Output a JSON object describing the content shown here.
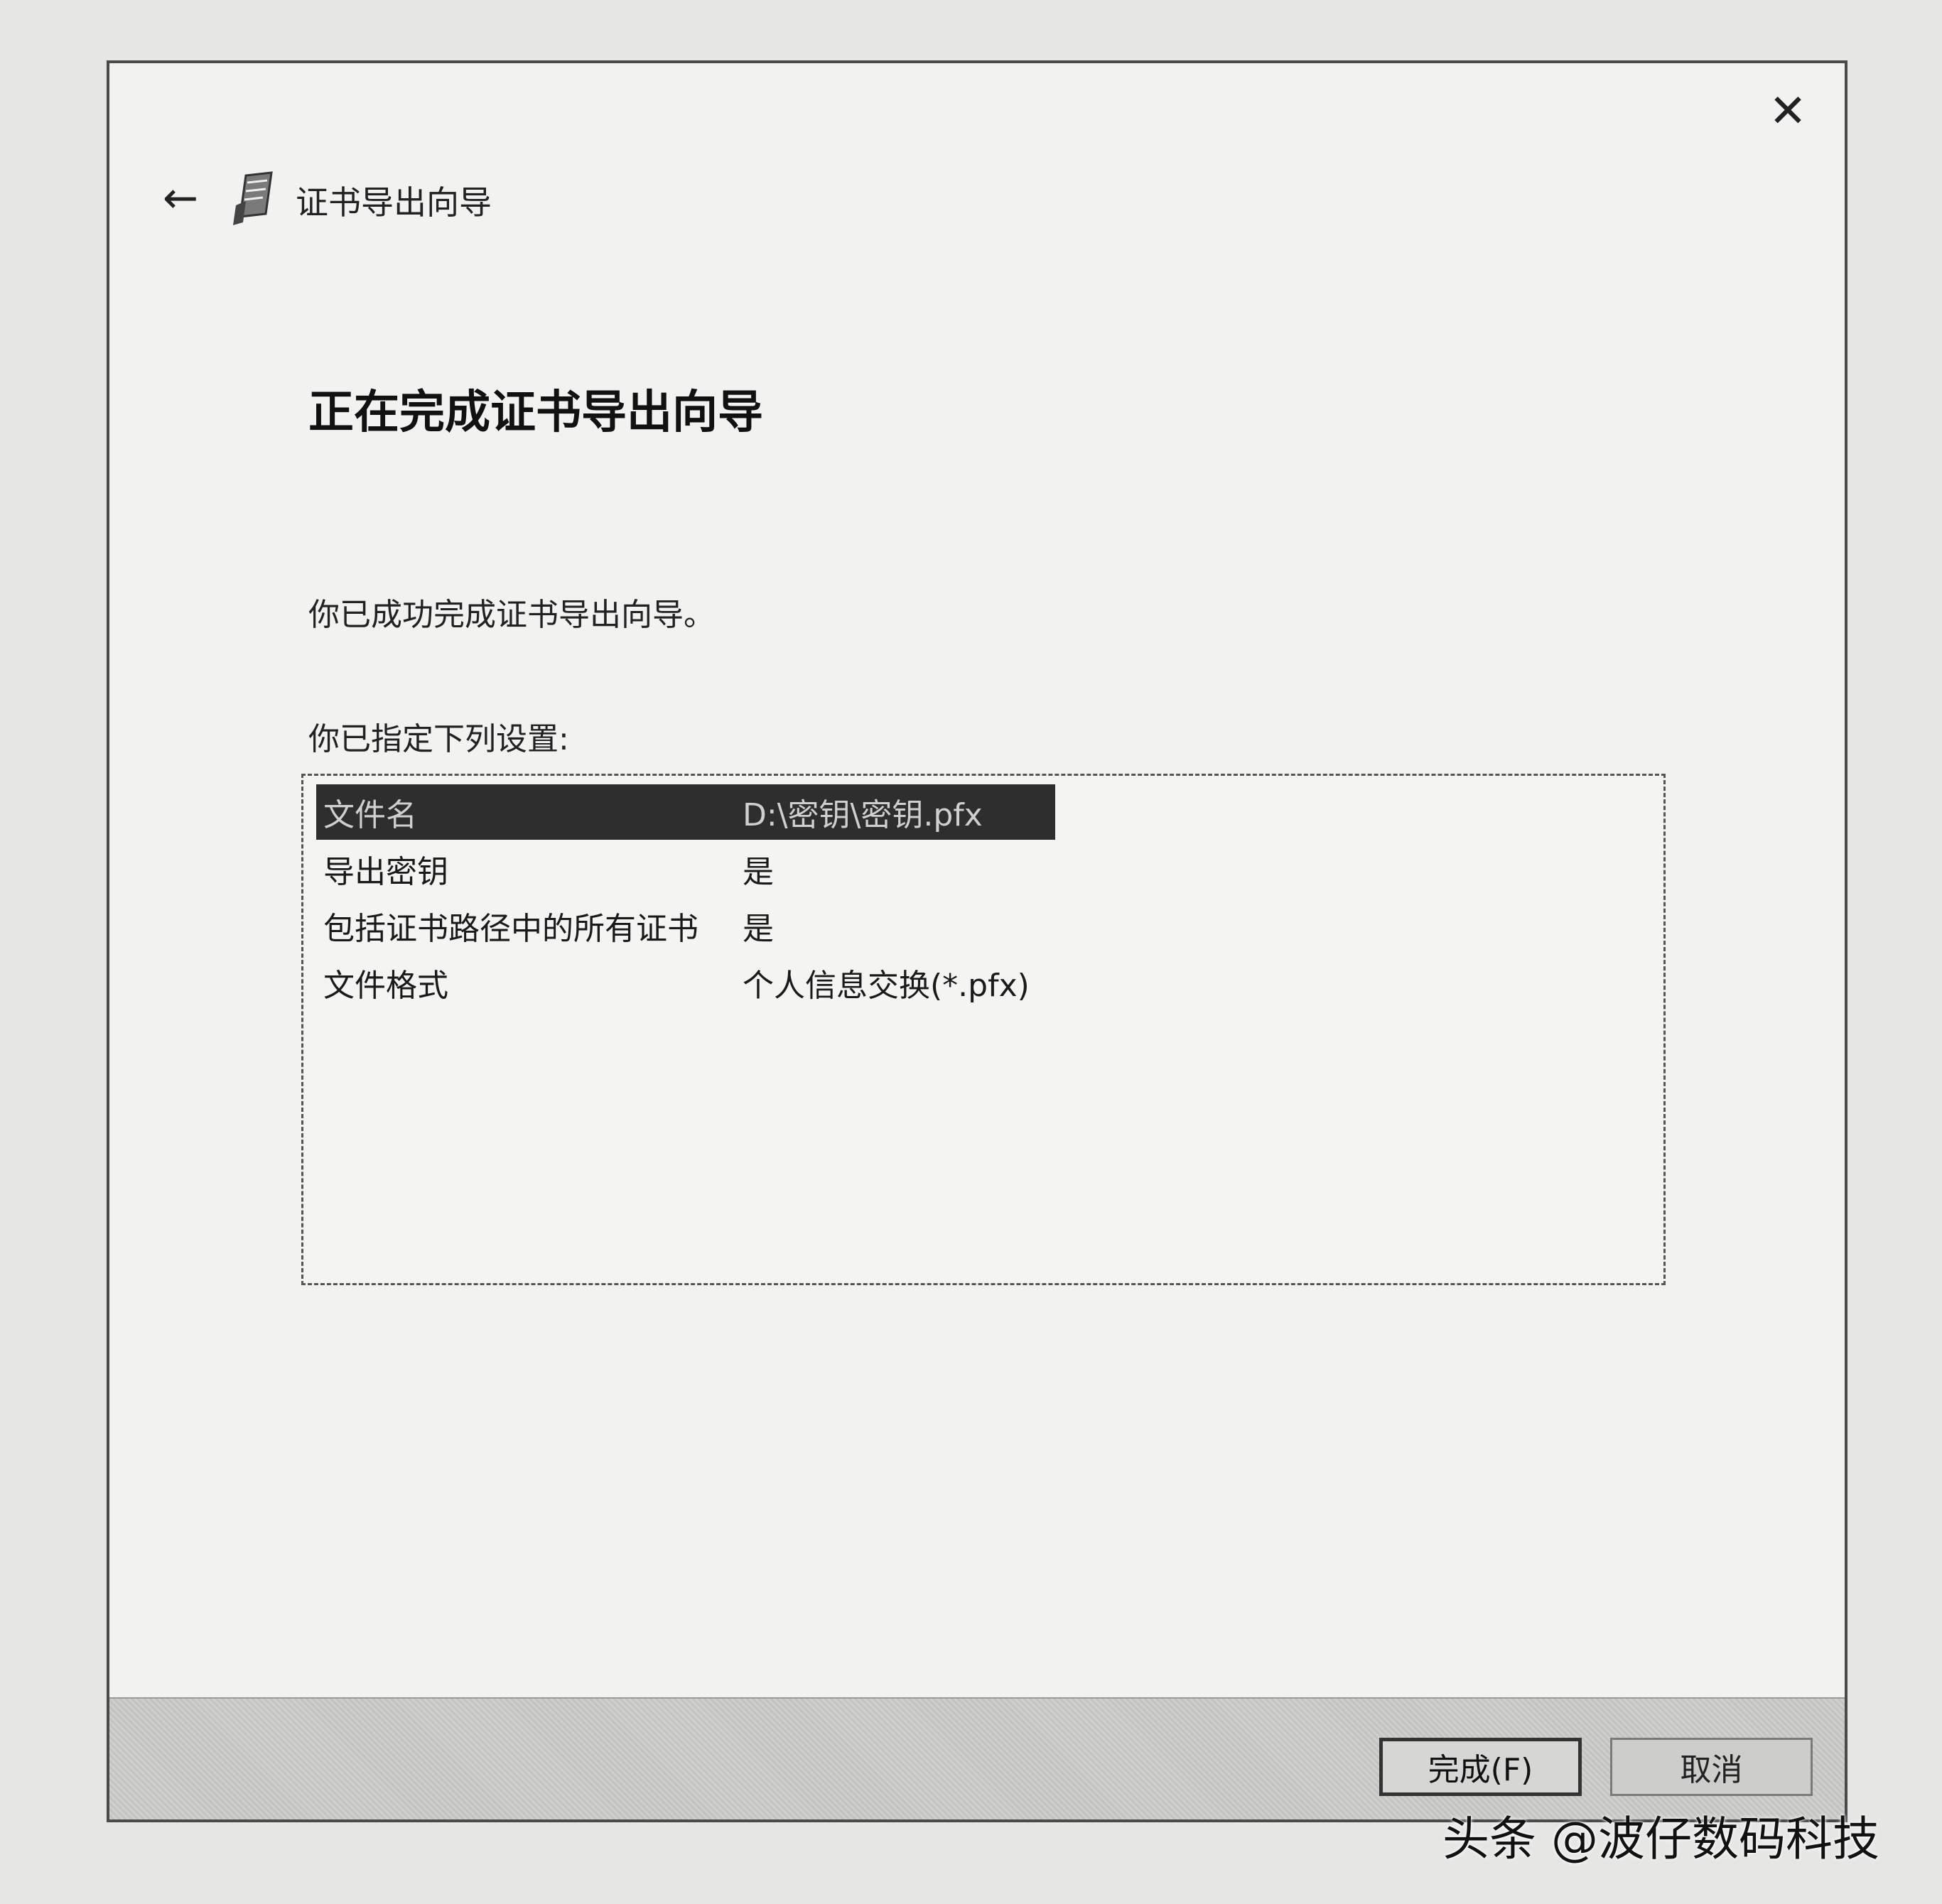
{
  "window": {
    "title": "证书导出向导",
    "close_glyph": "✕",
    "back_glyph": "←"
  },
  "heading": "正在完成证书导出向导",
  "success_text": "你已成功完成证书导出向导。",
  "settings_label": "你已指定下列设置:",
  "settings": [
    {
      "key": "文件名",
      "value": "D:\\密钥\\密钥.pfx"
    },
    {
      "key": "导出密钥",
      "value": "是"
    },
    {
      "key": "包括证书路径中的所有证书",
      "value": "是"
    },
    {
      "key": "文件格式",
      "value": "个人信息交换(*.pfx)"
    }
  ],
  "buttons": {
    "finish": "完成(F)",
    "cancel": "取消"
  },
  "watermark": "头条 @波仔数码科技",
  "icons": [
    "close-icon",
    "back-arrow-icon",
    "certificate-wizard-icon"
  ],
  "colors": {
    "selection_bg": "#2e2e2e",
    "dialog_bg": "#f2f2f1"
  }
}
